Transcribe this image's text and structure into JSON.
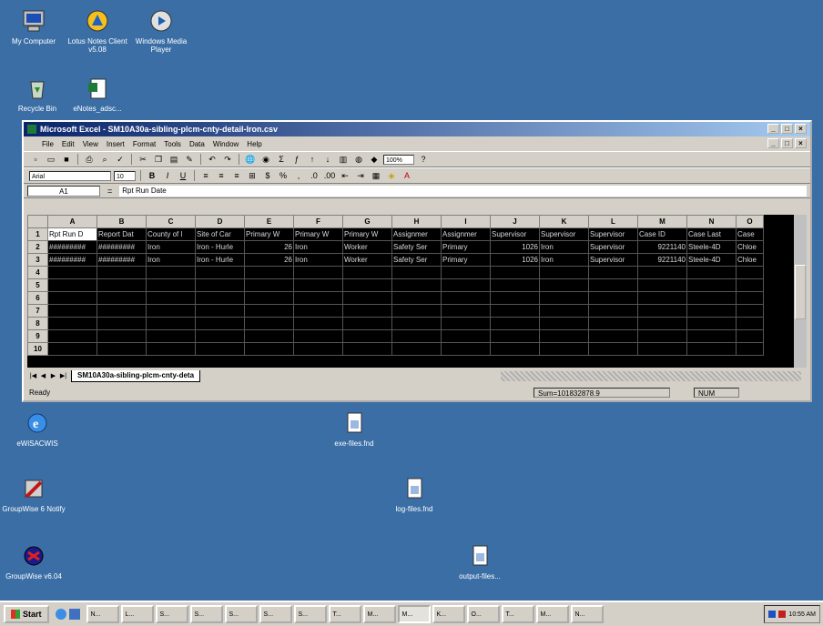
{
  "desktop": {
    "icons": [
      {
        "label": "My Computer",
        "icon": "computer-icon"
      },
      {
        "label": "Lotus Notes Client v5.08",
        "icon": "lotus-notes-icon"
      },
      {
        "label": "Windows Media Player",
        "icon": "media-player-icon"
      },
      {
        "label": "Recycle Bin",
        "icon": "recycle-bin-icon"
      },
      {
        "label": "eNotes_adsc...",
        "icon": "document-icon"
      },
      {
        "label": "eWiSACWIS",
        "icon": "internet-explorer-icon"
      },
      {
        "label": "exe-files.fnd",
        "icon": "file-icon"
      },
      {
        "label": "GroupWise 6 Notify",
        "icon": "groupwise-notify-icon"
      },
      {
        "label": "log-files.fnd",
        "icon": "file-icon"
      },
      {
        "label": "GroupWise v6.04",
        "icon": "groupwise-icon"
      },
      {
        "label": "output-files...",
        "icon": "file-icon"
      }
    ]
  },
  "excel": {
    "title": "Microsoft Excel - SM10A30a-sibling-plcm-cnty-detail-Iron.csv",
    "menu": [
      "File",
      "Edit",
      "View",
      "Insert",
      "Format",
      "Tools",
      "Data",
      "Window",
      "Help"
    ],
    "font": "Arial",
    "font_size": "10",
    "zoom": "100%",
    "name_box": "A1",
    "formula": "Rpt Run Date",
    "columns": [
      "A",
      "B",
      "C",
      "D",
      "E",
      "F",
      "G",
      "H",
      "I",
      "J",
      "K",
      "L",
      "M",
      "N",
      "O"
    ],
    "rows": [
      [
        "1",
        "Rpt Run D",
        "Report Dat",
        "County of l",
        "Site of Car",
        "Primary W",
        "Primary W",
        "Primary W",
        "Assignmer",
        "Assignmer",
        "Supervisor",
        "Supervisor",
        "Supervisor",
        "Case ID",
        "Case Last",
        "Case"
      ],
      [
        "2",
        "#########",
        "#########",
        "Iron",
        "Iron - Hurle",
        "26",
        "Iron",
        "Worker",
        "Safety Ser",
        "Primary",
        "1026",
        "Iron",
        "Supervisor",
        "9221140",
        "Steele-4D",
        "Chloe"
      ],
      [
        "3",
        "#########",
        "#########",
        "Iron",
        "Iron - Hurle",
        "26",
        "Iron",
        "Worker",
        "Safety Ser",
        "Primary",
        "1026",
        "Iron",
        "Supervisor",
        "9221140",
        "Steele-4D",
        "Chloe"
      ],
      [
        "4",
        "",
        "",
        "",
        "",
        "",
        "",
        "",
        "",
        "",
        "",
        "",
        "",
        "",
        "",
        ""
      ],
      [
        "5",
        "",
        "",
        "",
        "",
        "",
        "",
        "",
        "",
        "",
        "",
        "",
        "",
        "",
        "",
        ""
      ],
      [
        "6",
        "",
        "",
        "",
        "",
        "",
        "",
        "",
        "",
        "",
        "",
        "",
        "",
        "",
        "",
        ""
      ],
      [
        "7",
        "",
        "",
        "",
        "",
        "",
        "",
        "",
        "",
        "",
        "",
        "",
        "",
        "",
        "",
        ""
      ],
      [
        "8",
        "",
        "",
        "",
        "",
        "",
        "",
        "",
        "",
        "",
        "",
        "",
        "",
        "",
        "",
        ""
      ],
      [
        "9",
        "",
        "",
        "",
        "",
        "",
        "",
        "",
        "",
        "",
        "",
        "",
        "",
        "",
        "",
        ""
      ],
      [
        "10",
        "",
        "",
        "",
        "",
        "",
        "",
        "",
        "",
        "",
        "",
        "",
        "",
        "",
        "",
        ""
      ]
    ],
    "sheet_tab": "SM10A30a-sibling-plcm-cnty-deta",
    "status": "Ready",
    "sum": "Sum=101832878.9",
    "num": "NUM"
  },
  "taskbar": {
    "start": "Start",
    "buttons": [
      "N...",
      "L...",
      "S...",
      "S...",
      "S...",
      "S...",
      "S...",
      "T...",
      "M...",
      "M...",
      "K...",
      "O...",
      "T...",
      "M...",
      "N..."
    ],
    "active_index": 9,
    "clock": "10:55 AM"
  }
}
